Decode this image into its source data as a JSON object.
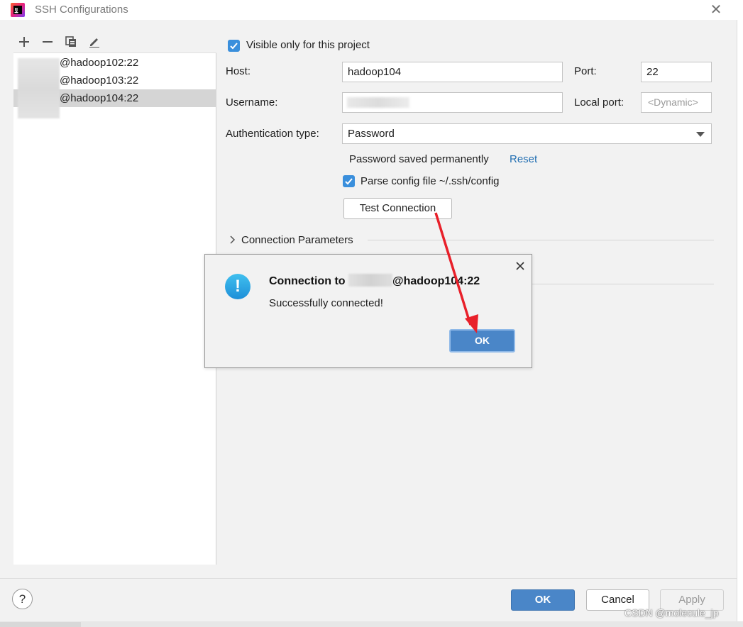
{
  "window": {
    "title": "SSH Configurations",
    "close_glyph": "✕"
  },
  "toolbar": {
    "add_icon": "plus-icon",
    "remove_icon": "minus-icon",
    "copy_icon": "copy-icon",
    "edit_icon": "edit-icon"
  },
  "hosts": [
    {
      "label": "@hadoop102:22",
      "selected": false
    },
    {
      "label": "@hadoop103:22",
      "selected": false
    },
    {
      "label": "@hadoop104:22",
      "selected": true
    }
  ],
  "form": {
    "visible_only_label": "Visible only for this project",
    "visible_only_checked": true,
    "host_label": "Host:",
    "host_value": "hadoop104",
    "port_label": "Port:",
    "port_value": "22",
    "username_label": "Username:",
    "local_port_label": "Local port:",
    "local_port_placeholder": "<Dynamic>",
    "auth_label": "Authentication type:",
    "auth_value": "Password",
    "password_saved_text": "Password saved permanently",
    "reset_link": "Reset",
    "parse_config_label": "Parse config file ~/.ssh/config",
    "parse_config_checked": true,
    "test_connection_label": "Test Connection",
    "connection_params_label": "Connection Parameters"
  },
  "dialog": {
    "title_prefix": "Connection to",
    "title_suffix": "@hadoop104:22",
    "message": "Successfully connected!",
    "ok_label": "OK",
    "icon": "info-icon",
    "close_glyph": "✕"
  },
  "footer": {
    "help_label": "?",
    "ok_label": "OK",
    "cancel_label": "Cancel",
    "apply_label": "Apply"
  },
  "watermark": "CSDN @molecule_jp",
  "colors": {
    "accent": "#4a86c8",
    "link": "#2470b3",
    "checkbox": "#3a8fdc",
    "annotation_arrow": "#e8202a"
  }
}
